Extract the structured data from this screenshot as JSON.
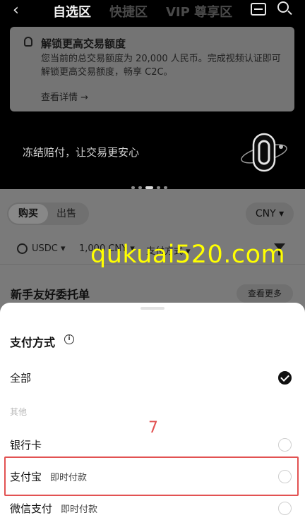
{
  "nav": {
    "back_glyph": "‹",
    "tabs": [
      "自选区",
      "快捷区",
      "VIP 尊享区"
    ],
    "active_tab": "自选区"
  },
  "info_card": {
    "title": "解锁更高交易额度",
    "body": "您当前的总交易额度为 20,000 人民币。完成视频认证即可解锁更高交易额度，畅享 C2C。",
    "link": "查看详情 →"
  },
  "banner": {
    "text": "冻结赔付，让交易更安心"
  },
  "trade": {
    "buy_label": "购买",
    "sell_label": "出售",
    "currency": "CNY ▾",
    "coin": "USDC ▾",
    "amount": "1,000 CNY ▾",
    "payment_filter": "支付方式 ▾"
  },
  "newbie": {
    "title": "新手友好委托单",
    "more_label": "查看更多"
  },
  "watermark": "qukuai520.com",
  "sheet": {
    "title": "支付方式",
    "options": [
      {
        "label": "全部",
        "sub": "",
        "selected": true
      },
      {
        "label": "银行卡",
        "sub": "",
        "selected": false
      },
      {
        "label": "支付宝",
        "sub": "即时付款",
        "selected": false
      },
      {
        "label": "微信支付",
        "sub": "即时付款",
        "selected": false
      }
    ],
    "group_label": "其他",
    "step_marker": "7"
  },
  "colors": {
    "highlight": "#e25252",
    "watermark": "#ffff00"
  }
}
